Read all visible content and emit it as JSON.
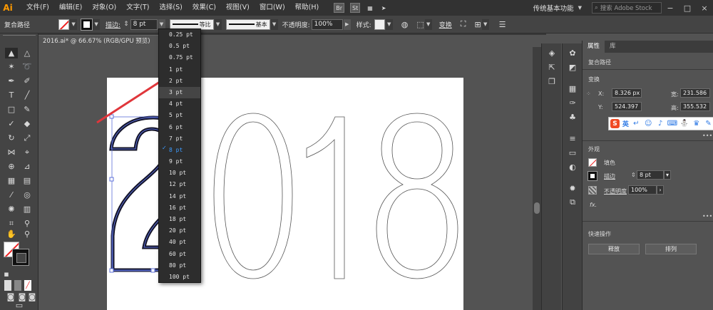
{
  "app": {
    "logo": "Ai"
  },
  "menu": [
    "文件(F)",
    "编辑(E)",
    "对象(O)",
    "文字(T)",
    "选择(S)",
    "效果(C)",
    "视图(V)",
    "窗口(W)",
    "帮助(H)"
  ],
  "menubar_icons": {
    "bridge": "Br",
    "stock": "St"
  },
  "workspace": "传统基本功能",
  "search": {
    "placeholder": "搜索 Adobe Stock"
  },
  "control": {
    "object_type": "复合路径",
    "stroke_label": "描边:",
    "stroke_value": "8 pt",
    "profile_label": "等比",
    "brush_label": "基本",
    "opacity_label": "不透明度:",
    "opacity_value": "100%",
    "style_label": "样式:",
    "transform_label": "变换"
  },
  "document": {
    "tab_title": "2016.ai* @ 66.67% (RGB/GPU 预览)"
  },
  "stroke_weights": [
    "0.25 pt",
    "0.5 pt",
    "0.75 pt",
    "1 pt",
    "2 pt",
    "3 pt",
    "4 pt",
    "5 pt",
    "6 pt",
    "7 pt",
    "8 pt",
    "9 pt",
    "10 pt",
    "12 pt",
    "14 pt",
    "16 pt",
    "18 pt",
    "20 pt",
    "40 pt",
    "60 pt",
    "80 pt",
    "100 pt"
  ],
  "stroke_selected": "8 pt",
  "stroke_hover": "3 pt",
  "canvas": {
    "artwork_text": "2018"
  },
  "panel": {
    "tabs": [
      "属性",
      "库"
    ],
    "object_type": "复合路径",
    "transform_title": "变换",
    "x_label": "X:",
    "x_value": "8.326 px",
    "y_label": "Y:",
    "y_value": "524.397",
    "w_label": "宽:",
    "w_value": "231.586",
    "h_label": "高:",
    "h_value": "355.532",
    "appearance_title": "外观",
    "fill_label": "填色",
    "stroke_label": "描边",
    "stroke_value": "8 pt",
    "opacity_label": "不透明度",
    "opacity_value": "100%",
    "fx_label": "fx.",
    "quick_actions_title": "快速操作",
    "release_button": "释放",
    "arrange_button": "排列"
  },
  "ime": {
    "logo": "S",
    "mode": "英"
  },
  "colors": {
    "accent": "#3d9bff",
    "none_slash": "#ee2222",
    "ai_orange": "#ff9a00",
    "arrow_red": "#e0363b"
  }
}
